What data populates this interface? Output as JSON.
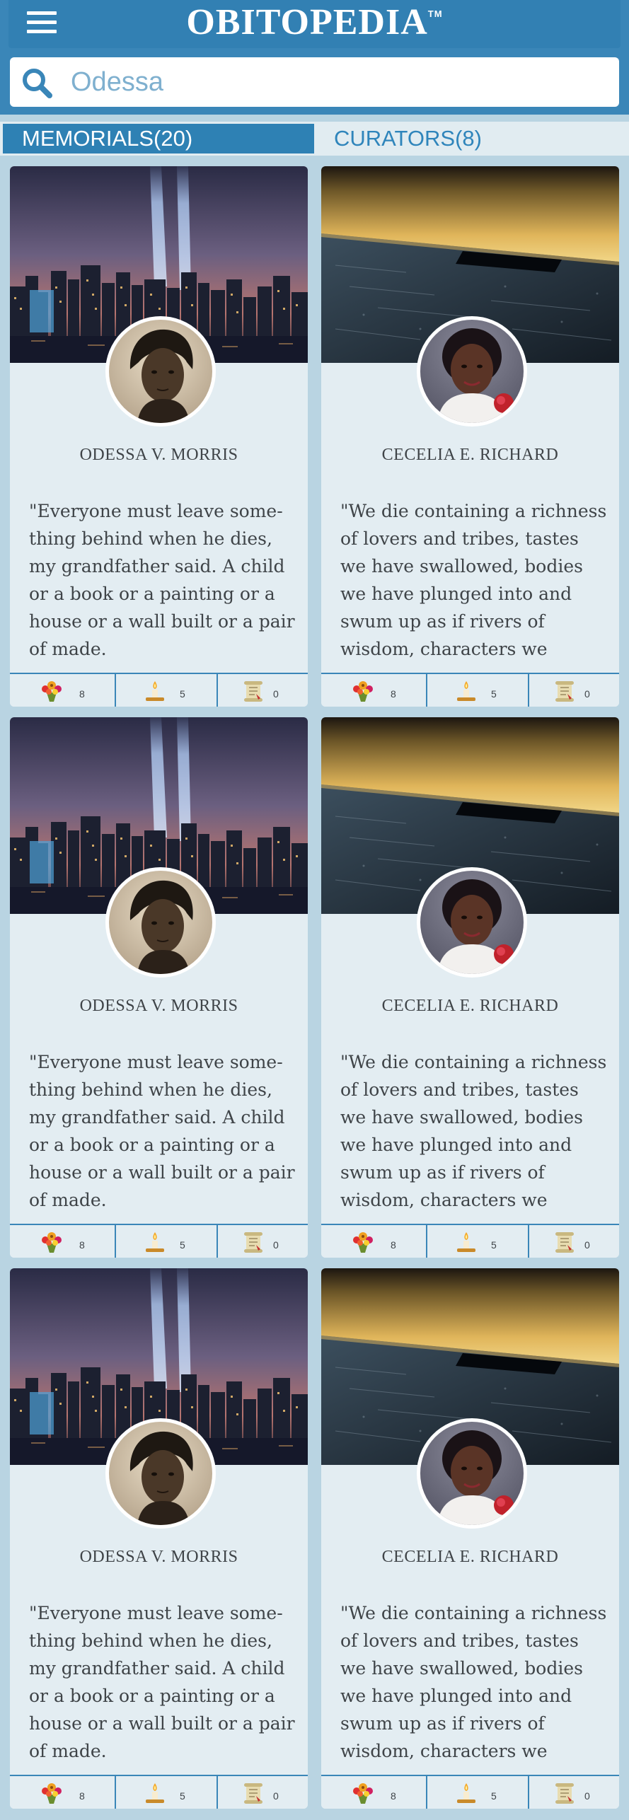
{
  "header": {
    "brand": "OBITOPEDIA",
    "trademark": "TM",
    "menu_icon": "hamburger-icon"
  },
  "search": {
    "value": "Odessa",
    "icon": "search-icon"
  },
  "tabs": [
    {
      "label": "MEMORIALS(20)",
      "active": true
    },
    {
      "label": "CURATORS(8)",
      "active": false
    }
  ],
  "cards": [
    {
      "name": "ODESSA V. MORRIS",
      "quote": "\"Everyone must leave some-thing behind when he dies, my grandfather said. A child or a book or a painting or a house or a wall built or a pair of made.",
      "background": "skyline-tribute-lights",
      "flowers": "8",
      "candles": "5",
      "scrolls": "0"
    },
    {
      "name": "CECELIA E. RICHARD",
      "quote": "\"We die containing a richness of lovers and tribes, tastes we have swallowed, bodies we have plunged into and swum up as if rivers of wisdom, characters we",
      "background": "memorial-pool",
      "flowers": "8",
      "candles": "5",
      "scrolls": "0"
    },
    {
      "name": "ODESSA V. MORRIS",
      "quote": "\"Everyone must leave some-thing behind when he dies, my grandfather said. A child or a book or a painting or a house or a wall built or a pair of made.",
      "background": "skyline-tribute-lights",
      "flowers": "8",
      "candles": "5",
      "scrolls": "0"
    },
    {
      "name": "CECELIA E. RICHARD",
      "quote": "\"We die containing a richness of lovers and tribes, tastes we have swallowed, bodies we have plunged into and swum up as if rivers of wisdom, characters we",
      "background": "memorial-pool",
      "flowers": "8",
      "candles": "5",
      "scrolls": "0"
    },
    {
      "name": "ODESSA V. MORRIS",
      "quote": "\"Everyone must leave some-thing behind when he dies, my grandfather said. A child or a book or a painting or a house or a wall built or a pair of made.",
      "background": "skyline-tribute-lights",
      "flowers": "8",
      "candles": "5",
      "scrolls": "0"
    },
    {
      "name": "CECELIA E. RICHARD",
      "quote": "\"We die containing a richness of lovers and tribes, tastes we have swallowed, bodies we have plunged into and swum up as if rivers of wisdom, characters we",
      "background": "memorial-pool",
      "flowers": "8",
      "candles": "5",
      "scrolls": "0"
    }
  ],
  "stat_icons": [
    "flower-bouquet-icon",
    "candle-icon",
    "scroll-icon"
  ],
  "colors": {
    "header_blue": "#3a86b8",
    "tab_active": "#2e81b4",
    "card_bg": "#e3edf2",
    "page_bg": "#b9d4e2",
    "text": "#3f4448"
  }
}
